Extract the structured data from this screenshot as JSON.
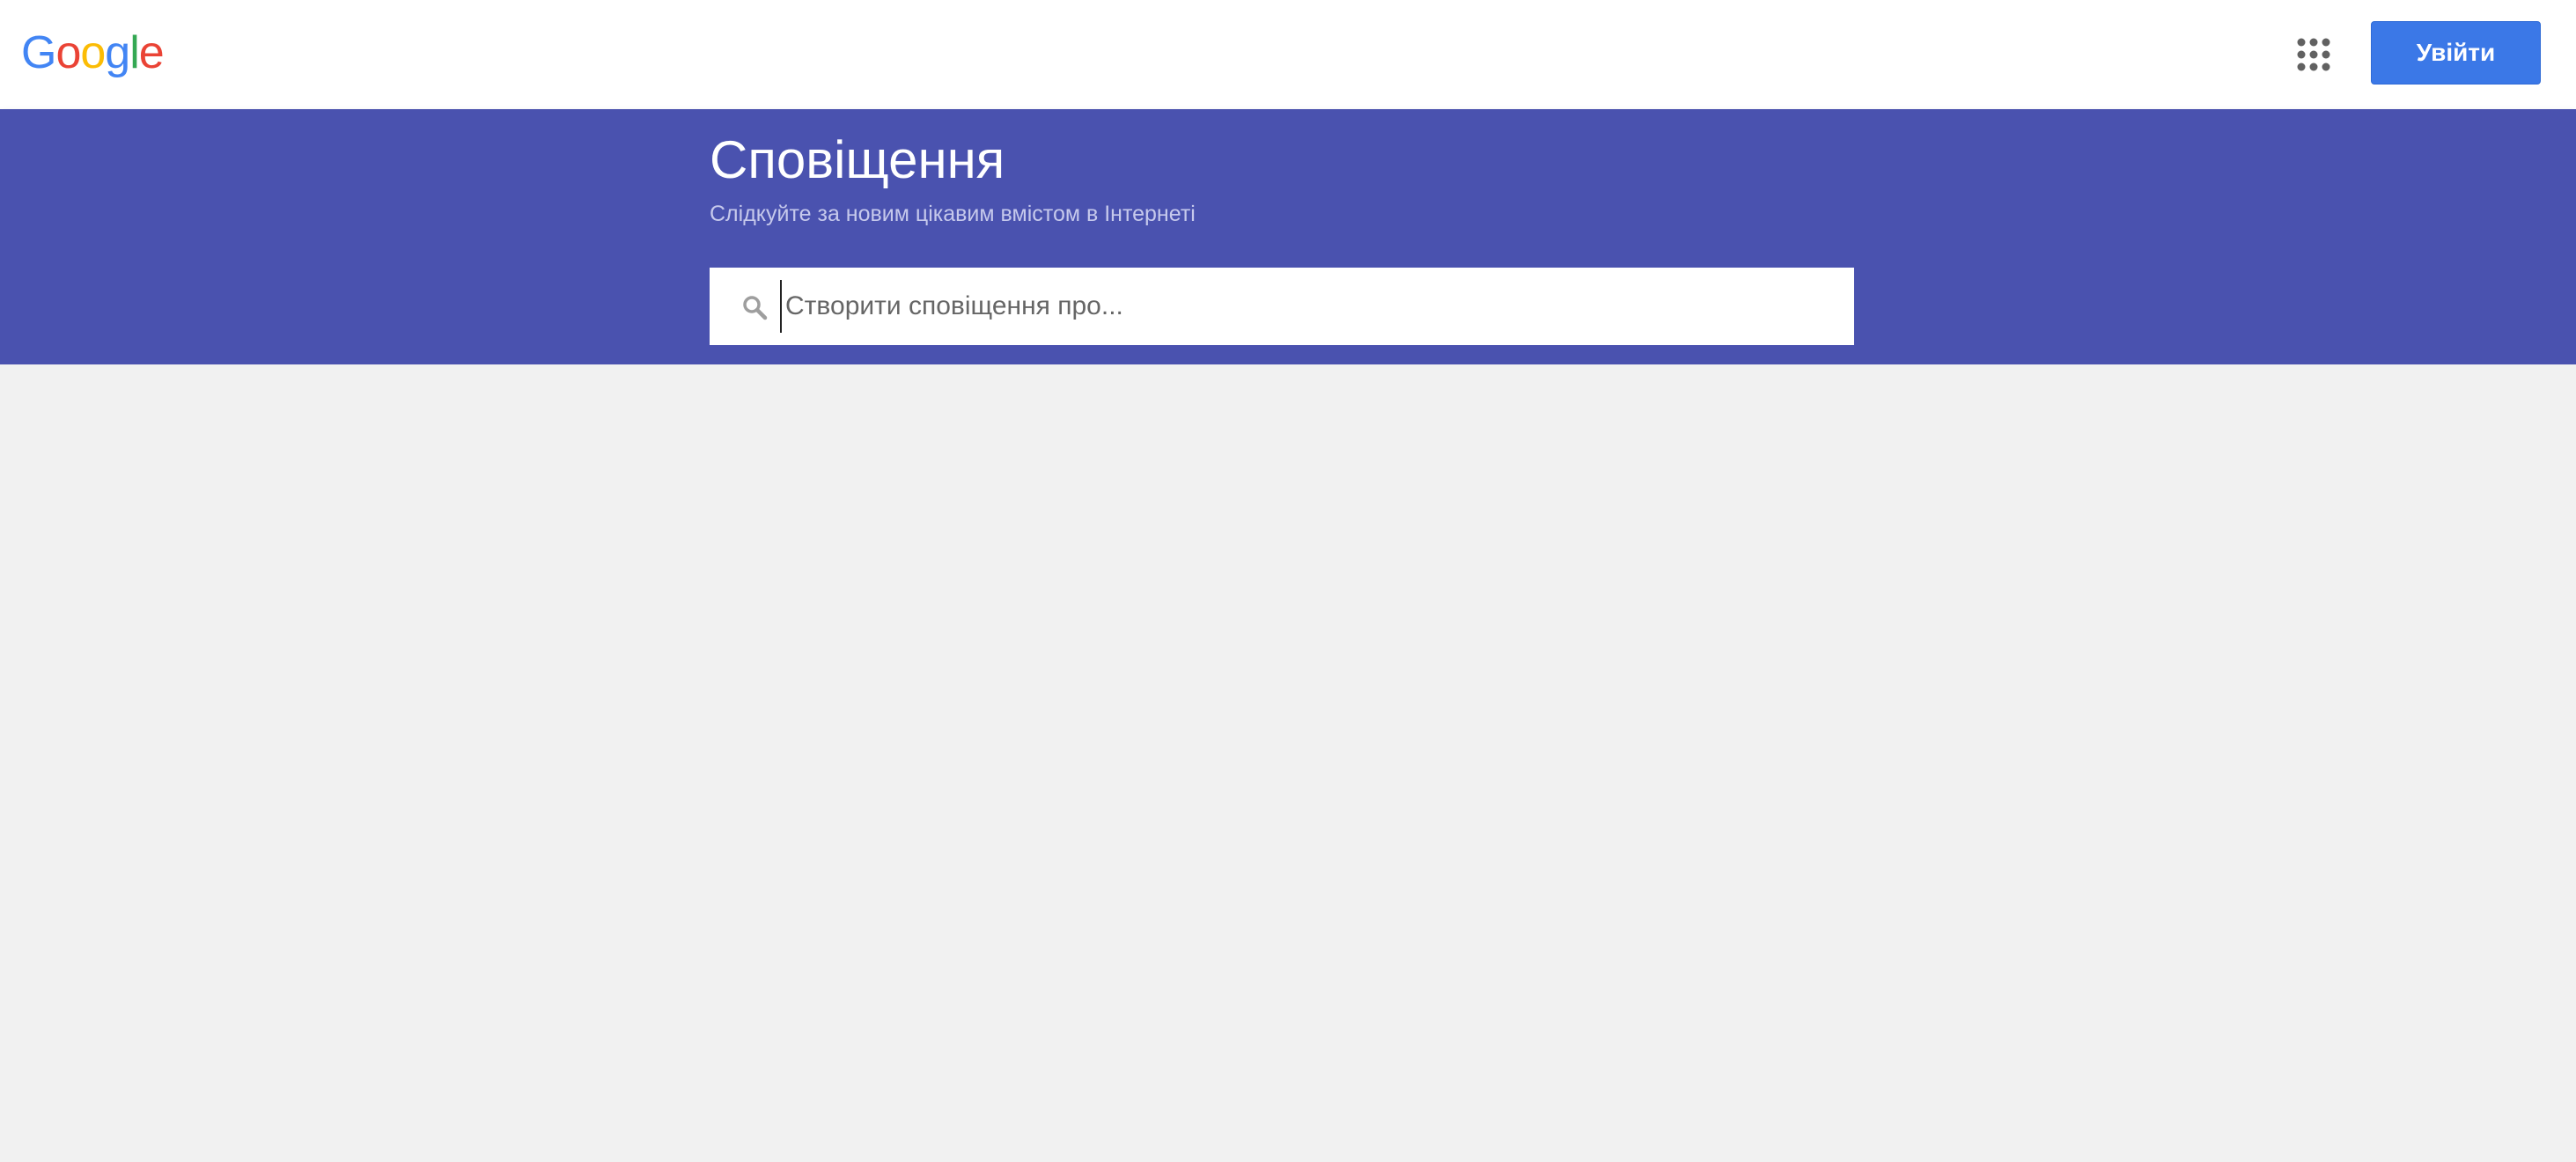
{
  "header": {
    "logo": {
      "letters": [
        {
          "char": "G",
          "color": "#4285f4"
        },
        {
          "char": "o",
          "color": "#ea4335"
        },
        {
          "char": "o",
          "color": "#fbbc05"
        },
        {
          "char": "g",
          "color": "#4285f4"
        },
        {
          "char": "l",
          "color": "#34a853"
        },
        {
          "char": "e",
          "color": "#ea4335"
        }
      ]
    },
    "apps_icon": "apps-grid-icon",
    "signin_label": "Увійти",
    "signin_color": "#3b78e7"
  },
  "banner": {
    "title": "Сповіщення",
    "subtitle": "Слідкуйте за новим цікавим вмістом в Інтернеті",
    "background_color": "#4a52af"
  },
  "search": {
    "icon": "search-icon",
    "placeholder": "Створити сповіщення про...",
    "value": ""
  }
}
